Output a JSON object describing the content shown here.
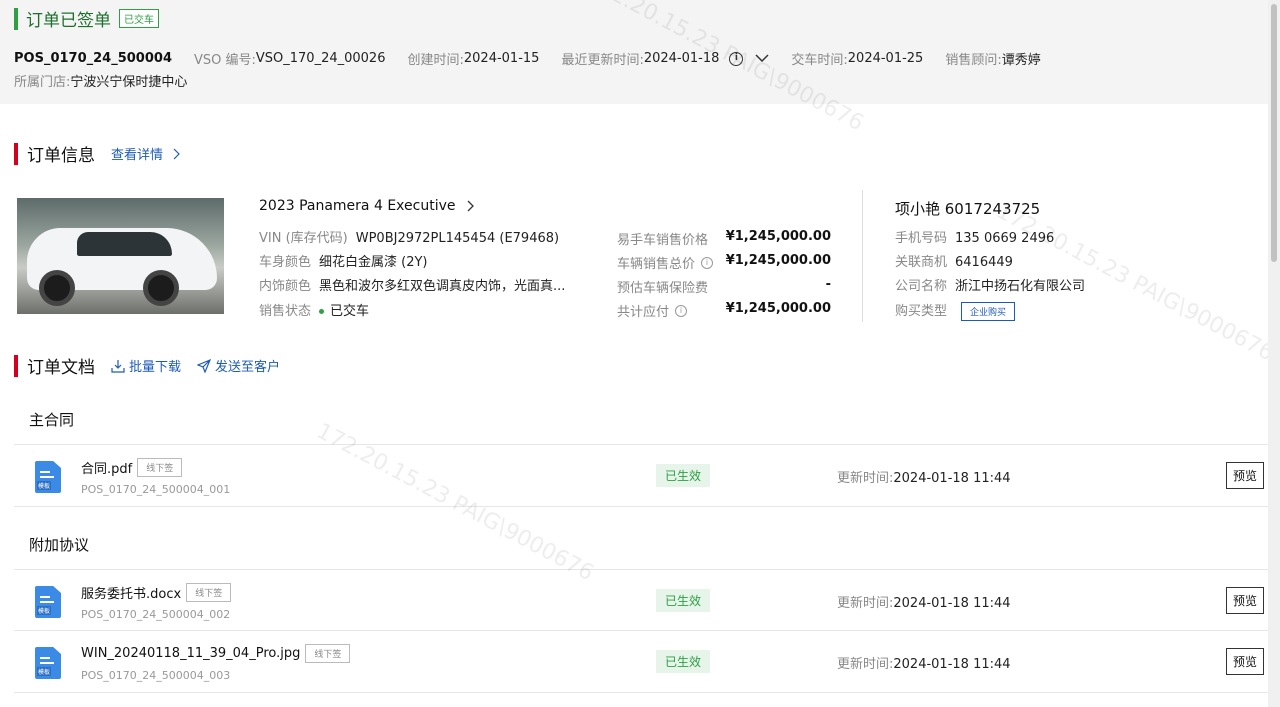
{
  "header": {
    "title": "订单已签单",
    "status_tag": "已交车",
    "pos_no": "POS_0170_24_500004",
    "vso_label": "VSO 编号:",
    "vso_value": "VSO_170_24_00026",
    "created_label": "创建时间:",
    "created_value": "2024-01-15",
    "updated_label": "最近更新时间:",
    "updated_value": "2024-01-18",
    "delivery_label": "交车时间:",
    "delivery_value": "2024-01-25",
    "consultant_label": "销售顾问:",
    "consultant_value": "谭秀婷",
    "store_label": "所属门店:",
    "store_value": "宁波兴宁保时捷中心"
  },
  "order_info": {
    "section_title": "订单信息",
    "details_link": "查看详情",
    "car_model": "2023 Panamera 4 Executive",
    "vin_label": "VIN (库存代码)",
    "vin_value": "WP0BJ2972PL145454 (E79468)",
    "body_color_label": "车身颜色",
    "body_color_value": "细花白金属漆 (2Y)",
    "interior_label": "内饰颜色",
    "interior_value": "黑色和波尔多红双色调真皮内饰，光面真...",
    "sale_status_label": "销售状态",
    "sale_status_value": "已交车",
    "prices": [
      {
        "label": "易手车销售价格",
        "value": "¥1,245,000.00",
        "info": false
      },
      {
        "label": "车辆销售总价",
        "value": "¥1,245,000.00",
        "info": true
      },
      {
        "label": "预估车辆保险费",
        "value": "-",
        "info": false
      },
      {
        "label": "共计应付",
        "value": "¥1,245,000.00",
        "info": true
      }
    ],
    "customer": {
      "name": "项小艳 6017243725",
      "phone_label": "手机号码",
      "phone_value": "135 0669 2496",
      "dealer_label": "关联商机",
      "dealer_value": "6416449",
      "company_label": "公司名称",
      "company_value": "浙江中扬石化有限公司",
      "purchase_label": "购买类型",
      "purchase_value": "企业购买"
    }
  },
  "documents": {
    "section_title": "订单文档",
    "batch_download": "批量下载",
    "send_to_customer": "发送至客户",
    "main_group": "主合同",
    "addendum_group": "附加协议",
    "file_badge": "模板",
    "items": [
      {
        "name": "合同.pdf",
        "tag": "线下签",
        "code": "POS_0170_24_500004_001",
        "status": "已生效",
        "updated_label": "更新时间:",
        "updated_value": "2024-01-18 11:44",
        "action": "预览"
      },
      {
        "name": "服务委托书.docx",
        "tag": "线下签",
        "code": "POS_0170_24_500004_002",
        "status": "已生效",
        "updated_label": "更新时间:",
        "updated_value": "2024-01-18 11:44",
        "action": "预览"
      },
      {
        "name": "WIN_20240118_11_39_04_Pro.jpg",
        "tag": "线下签",
        "code": "POS_0170_24_500004_003",
        "status": "已生效",
        "updated_label": "更新时间:",
        "updated_value": "2024-01-18 11:44",
        "action": "预览"
      }
    ]
  },
  "watermark": "172.20.15.23 PAIG\\9000676",
  "colors": {
    "accent_green": "#2ea043",
    "accent_red": "#d5001c",
    "link_blue": "#1d5bb8"
  }
}
